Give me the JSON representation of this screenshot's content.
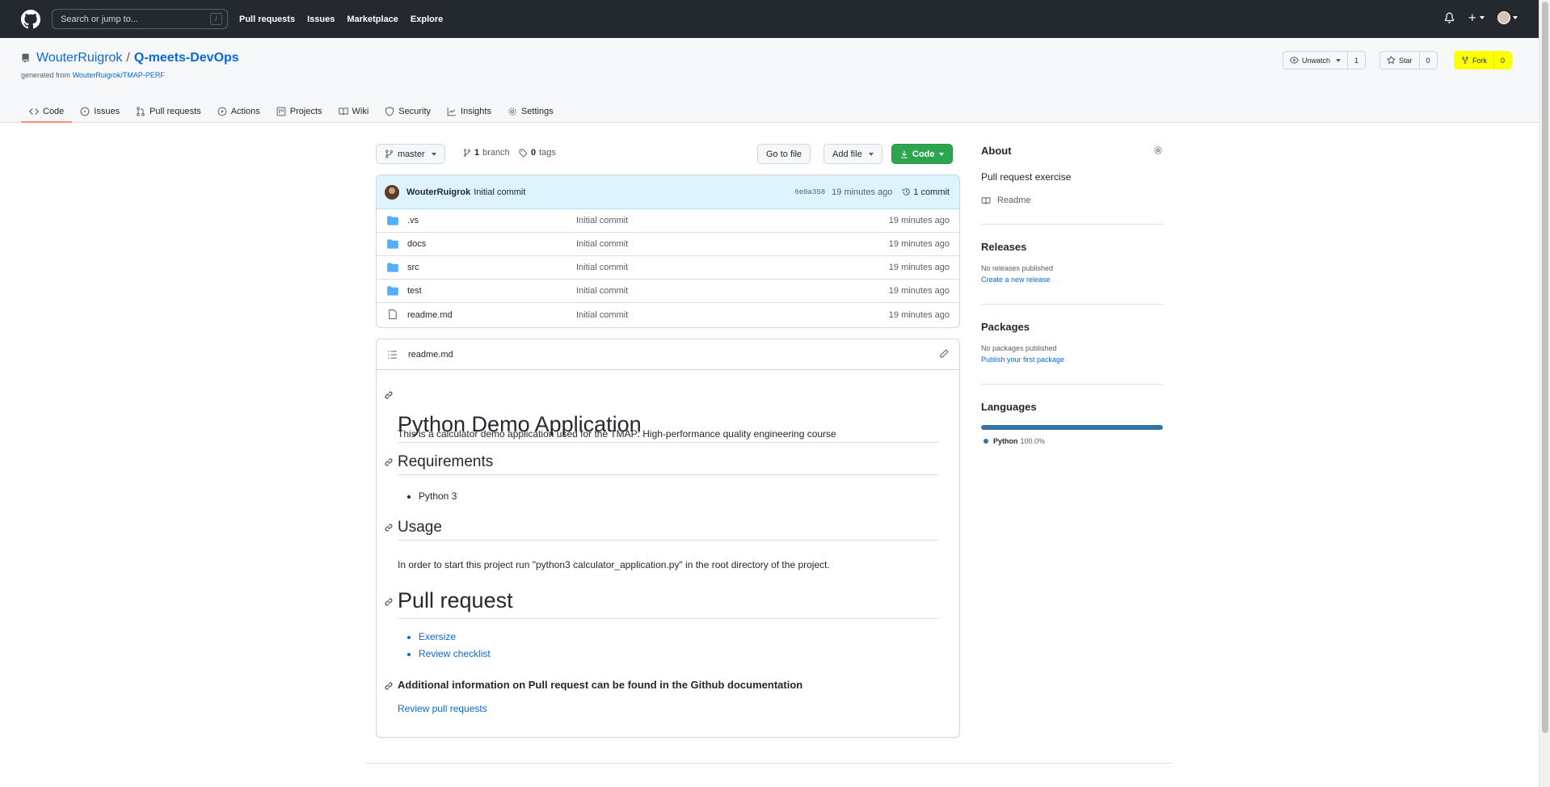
{
  "header": {
    "search_placeholder": "Search or jump to...",
    "search_shortcut": "/",
    "nav": [
      "Pull requests",
      "Issues",
      "Marketplace",
      "Explore"
    ]
  },
  "repo": {
    "owner": "WouterRuigrok",
    "separator": "/",
    "name": "Q-meets-DevOps",
    "generated_prefix": "generated from",
    "generated_link": "WouterRuigrok/TMAP-PERF",
    "watch_label": "Unwatch",
    "watch_count": "1",
    "star_label": "Star",
    "star_count": "0",
    "fork_label": "Fork",
    "fork_count": "0",
    "highlight_color": "#ffff00"
  },
  "tabs": [
    {
      "label": "Code",
      "icon": "code-icon"
    },
    {
      "label": "Issues",
      "icon": "issue-icon"
    },
    {
      "label": "Pull requests",
      "icon": "pull-request-icon"
    },
    {
      "label": "Actions",
      "icon": "play-icon"
    },
    {
      "label": "Projects",
      "icon": "project-icon"
    },
    {
      "label": "Wiki",
      "icon": "book-icon"
    },
    {
      "label": "Security",
      "icon": "shield-icon"
    },
    {
      "label": "Insights",
      "icon": "graph-icon"
    },
    {
      "label": "Settings",
      "icon": "gear-icon"
    }
  ],
  "toolbar": {
    "branch": "master",
    "branches_count": "1",
    "branches_label": "branch",
    "tags_count": "0",
    "tags_label": "tags",
    "goto_file": "Go to file",
    "add_file": "Add file",
    "code": "Code"
  },
  "latest_commit": {
    "author": "WouterRuigrok",
    "message": "Initial commit",
    "sha": "6e0a358",
    "time": "19 minutes ago",
    "commits": "1 commit"
  },
  "files": [
    {
      "name": ".vs",
      "type": "folder",
      "message": "Initial commit",
      "time": "19 minutes ago"
    },
    {
      "name": "docs",
      "type": "folder",
      "message": "Initial commit",
      "time": "19 minutes ago"
    },
    {
      "name": "src",
      "type": "folder",
      "message": "Initial commit",
      "time": "19 minutes ago"
    },
    {
      "name": "test",
      "type": "folder",
      "message": "Initial commit",
      "time": "19 minutes ago"
    },
    {
      "name": "readme.md",
      "type": "file",
      "message": "Initial commit",
      "time": "19 minutes ago"
    }
  ],
  "readme": {
    "filename": "readme.md",
    "h1": "Python Demo Application",
    "intro": "This is a calculator demo application used for the TMAP: High-performance quality engineering course",
    "req_heading": "Requirements",
    "req_item": "Python 3",
    "usage_heading": "Usage",
    "usage_text": "In order to start this project run \"python3 calculator_application.py\" in the root directory of the project.",
    "pr_heading": "Pull request",
    "pr_links": [
      "Exersize",
      "Review checklist"
    ],
    "extra_heading": "Additional information on Pull request can be found in the Github documentation",
    "extra_link": "Review pull requests"
  },
  "sidebar": {
    "about_heading": "About",
    "description": "Pull request exercise",
    "readme_label": "Readme",
    "releases_heading": "Releases",
    "releases_none": "No releases published",
    "releases_link": "Create a new release",
    "packages_heading": "Packages",
    "packages_none": "No packages published",
    "packages_link": "Publish your first package",
    "languages_heading": "Languages",
    "language_name": "Python",
    "language_percent": "100.0%",
    "language_share": 1.0,
    "language_color": "#3572A5"
  }
}
